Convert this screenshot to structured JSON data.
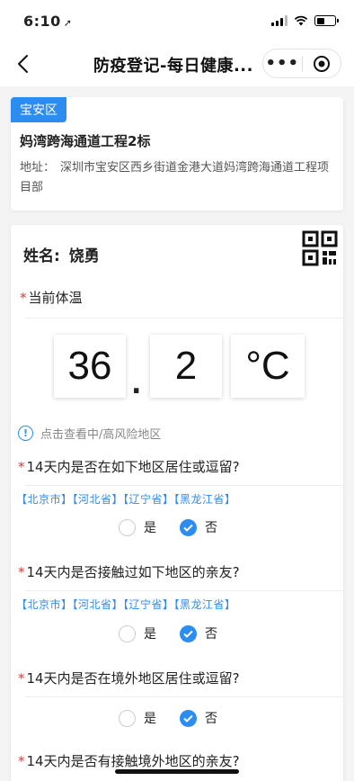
{
  "status": {
    "time": "6:10",
    "location_arrow": "➚"
  },
  "nav": {
    "title": "防疫登记-每日健康...",
    "more": "•••"
  },
  "site": {
    "district": "宝安区",
    "project_name": "妈湾跨海通道工程2标",
    "address_label": "地址：",
    "address": "深圳市宝安区西乡街道金港大道妈湾跨海通道工程项目部"
  },
  "form": {
    "name_label": "姓名:",
    "name_value": "饶勇",
    "required_mark": "*",
    "temp_label": "当前体温",
    "temp_integer": "36",
    "temp_dot": ".",
    "temp_decimal": "2",
    "temp_unit": "°C",
    "risk_link": "点击查看中/高风险地区",
    "info_icon_glyph": "!",
    "yes_label": "是",
    "no_label": "否",
    "questions": [
      {
        "label": "14天内是否在如下地区居住或逗留?",
        "regions": "【北京市】【河北省】【辽宁省】【黑龙江省】",
        "answer": "否"
      },
      {
        "label": "14天内是否接触过如下地区的亲友?",
        "regions": "【北京市】【河北省】【辽宁省】【黑龙江省】",
        "answer": "否"
      },
      {
        "label": "14天内是否在境外地区居住或逗留?",
        "regions": "",
        "answer": "否"
      },
      {
        "label": "14天内是否有接触境外地区的亲友?",
        "regions": "",
        "answer": ""
      }
    ]
  },
  "colors": {
    "accent": "#2d8cf0",
    "required": "#e33333"
  }
}
